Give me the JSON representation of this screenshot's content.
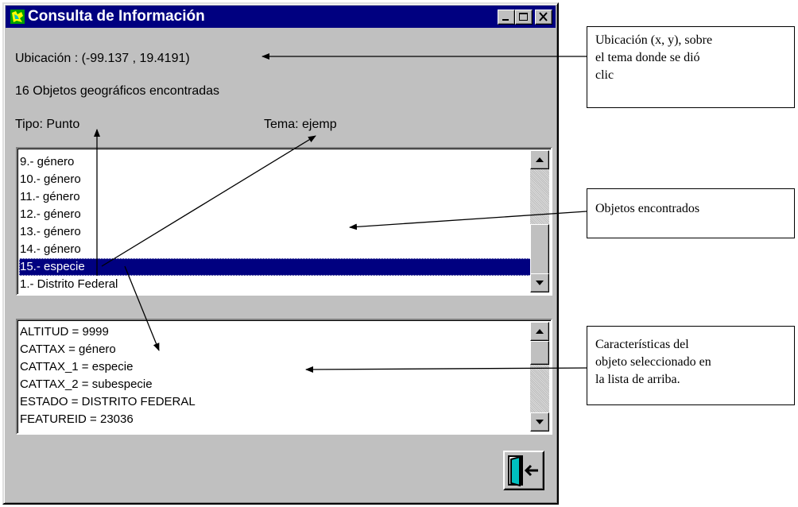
{
  "window": {
    "title": "Consulta de Información"
  },
  "info": {
    "location": "Ubicación :  (-99.137 , 19.4191)",
    "count": "16 Objetos geográficos encontradas",
    "type": "Tipo: Punto",
    "theme": "Tema:  ejemp"
  },
  "objects_list": {
    "items": [
      "9.- género",
      "10.- género",
      "11.- género",
      "12.- género",
      "13.- género",
      "14.- género",
      "15.- especie",
      "1.- Distrito Federal"
    ],
    "selected_index": 6
  },
  "attributes_list": {
    "items": [
      "ALTITUD = 9999",
      "CATTAX = género",
      "CATTAX_1 = especie",
      "CATTAX_2 = subespecie",
      "ESTADO = DISTRITO FEDERAL",
      "FEATUREID = 23036"
    ]
  },
  "callouts": {
    "location": [
      "Ubicación (x, y), sobre",
      "el tema donde se dió",
      "clic"
    ],
    "objects": [
      "Objetos encontrados"
    ],
    "attributes": [
      "Características del",
      "objeto seleccionado en",
      "la lista de arriba."
    ]
  },
  "colors": {
    "titlebar": "#000080",
    "face": "#c0c0c0",
    "selection": "#000080"
  },
  "icons": [
    "map-icon",
    "minimize-icon",
    "maximize-icon",
    "close-icon",
    "exit-door-icon",
    "arrow-up-icon",
    "arrow-down-icon"
  ]
}
